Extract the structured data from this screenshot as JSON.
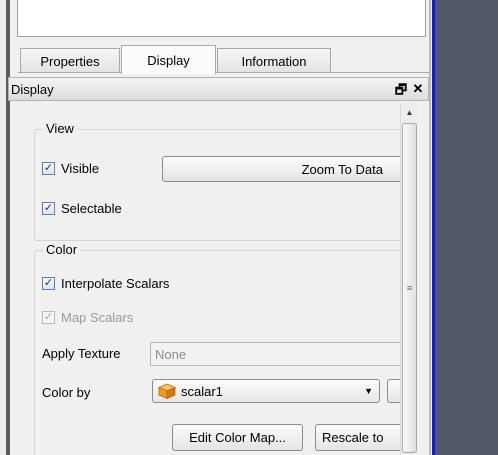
{
  "tabs": [
    {
      "label": "Properties"
    },
    {
      "label": "Display"
    },
    {
      "label": "Information"
    }
  ],
  "dock": {
    "title": "Display",
    "float_glyph": "🗗",
    "close_glyph": "✕"
  },
  "view_group": {
    "title": "View",
    "visible_label": "Visible",
    "visible_checked": true,
    "zoom_button": "Zoom To Data",
    "selectable_label": "Selectable",
    "selectable_checked": true
  },
  "color_group": {
    "title": "Color",
    "interpolate_label": "Interpolate Scalars",
    "interpolate_checked": true,
    "map_scalars_label": "Map Scalars",
    "map_scalars_checked": true,
    "apply_texture_label": "Apply Texture",
    "texture_value": "None",
    "color_by_label": "Color by",
    "color_by_value": "scalar1",
    "edit_color_map_button": "Edit Color Map...",
    "rescale_button": "Rescale to"
  },
  "icons": {
    "checkmark": "✓",
    "dropdown": "▼",
    "scroll_up": "▲",
    "grip": "≡"
  },
  "colors": {
    "viewport": "#525768",
    "render_border": "#1818d8"
  }
}
